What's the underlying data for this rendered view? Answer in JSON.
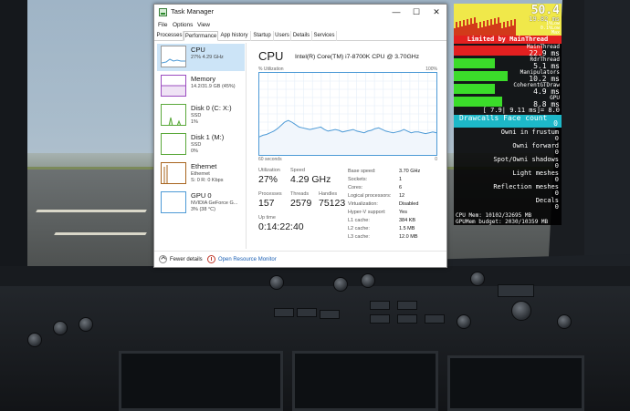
{
  "task_manager": {
    "title": "Task Manager",
    "menu": [
      "File",
      "Options",
      "View"
    ],
    "tabs": [
      "Processes",
      "Performance",
      "App history",
      "Startup",
      "Users",
      "Details",
      "Services"
    ],
    "active_tab": "Performance",
    "window_buttons": {
      "minimize": "—",
      "maximize": "☐",
      "close": "✕"
    },
    "sidebar": [
      {
        "name": "CPU",
        "sub1": "27% 4.29 GHz",
        "sub2": "",
        "color": "#4d9ad6",
        "active": true
      },
      {
        "name": "Memory",
        "sub1": "14.2/31.9 GB (45%)",
        "sub2": "",
        "color": "#9b4cc0",
        "active": false
      },
      {
        "name": "Disk 0 (C: X:)",
        "sub1": "SSD",
        "sub2": "1%",
        "color": "#5aa83a",
        "active": false
      },
      {
        "name": "Disk 1 (M:)",
        "sub1": "SSD",
        "sub2": "0%",
        "color": "#5aa83a",
        "active": false
      },
      {
        "name": "Ethernet",
        "sub1": "Ethernet",
        "sub2": "S: 0 R: 0 Kbps",
        "color": "#a8641e",
        "active": false
      },
      {
        "name": "GPU 0",
        "sub1": "NVIDIA GeForce G...",
        "sub2": "3% (38 °C)",
        "color": "#4d9ad6",
        "active": false
      }
    ],
    "cpu": {
      "title": "CPU",
      "model": "Intel(R) Core(TM) i7-8700K CPU @ 3.70GHz",
      "util_label": "% Utilization",
      "util_max": "100%",
      "graph_seconds": "60 seconds",
      "graph_zero": "0",
      "stats": {
        "utilization_label": "Utilization",
        "utilization": "27%",
        "speed_label": "Speed",
        "speed": "4.29 GHz",
        "processes_label": "Processes",
        "processes": "157",
        "threads_label": "Threads",
        "threads": "2579",
        "handles_label": "Handles",
        "handles": "75123",
        "uptime_label": "Up time",
        "uptime": "0:14:22:40"
      },
      "details": [
        {
          "label": "Base speed:",
          "value": "3.70 GHz"
        },
        {
          "label": "Sockets:",
          "value": "1"
        },
        {
          "label": "Cores:",
          "value": "6"
        },
        {
          "label": "Logical processors:",
          "value": "12"
        },
        {
          "label": "Virtualization:",
          "value": "Disabled"
        },
        {
          "label": "Hyper-V support:",
          "value": "Yes"
        },
        {
          "label": "L1 cache:",
          "value": "384 KB"
        },
        {
          "label": "L2 cache:",
          "value": "1.5 MB"
        },
        {
          "label": "L3 cache:",
          "value": "12.0 MB"
        }
      ],
      "history_percent": [
        22,
        24,
        25,
        27,
        29,
        32,
        36,
        40,
        42,
        40,
        37,
        34,
        33,
        32,
        31,
        32,
        33,
        34,
        31,
        29,
        30,
        31,
        30,
        28,
        29,
        30,
        31,
        29,
        28,
        27,
        29,
        30,
        32,
        33,
        31,
        29,
        28,
        27,
        28,
        29,
        31,
        29,
        27,
        28,
        28,
        27,
        26,
        27,
        28,
        27
      ]
    },
    "footer": {
      "fewer_details": "Fewer details",
      "open_resource_monitor": "Open Resource Monitor"
    }
  },
  "overlay": {
    "fps": "50.4",
    "frametime": "19.82 ms",
    "fps_lines": [
      "1%Low",
      "0.1%Low",
      "Max",
      "Min"
    ],
    "limited": "Limited by MainThread",
    "metrics": [
      {
        "label": "MainThread",
        "value": "22.9 ms",
        "fill": 0.82,
        "red": true
      },
      {
        "label": "RdrThread",
        "value": "5.1 ms",
        "fill": 0.38,
        "red": false
      },
      {
        "label": "Manipulators",
        "value": "10.2 ms",
        "fill": 0.5,
        "red": false
      },
      {
        "label": "CoherentGTDraw",
        "value": "4.9 ms",
        "fill": 0.38,
        "red": false
      },
      {
        "label": "GPU",
        "value": "8.8 ms",
        "fill": 0.45,
        "red": false
      }
    ],
    "gpu_extra": "[ 7.9| 9.11 ms]= 8.0",
    "drawcalls_label": "Drawcalls Face count",
    "drawcalls_value": "0",
    "rows": [
      {
        "label": "Owni in frustum",
        "value": "0"
      },
      {
        "label": "Owni forward",
        "value": "0"
      },
      {
        "label": "Spot/Owni shadows",
        "value": "0"
      },
      {
        "label": "Light meshes",
        "value": "0"
      },
      {
        "label": "Reflection meshes",
        "value": "0"
      },
      {
        "label": "Decals",
        "value": "0"
      }
    ],
    "cpu_mem": "CPU Mem: 10102/32695 MB",
    "gpu_mem": "GPUMem budget: 2030/10359 MB"
  }
}
